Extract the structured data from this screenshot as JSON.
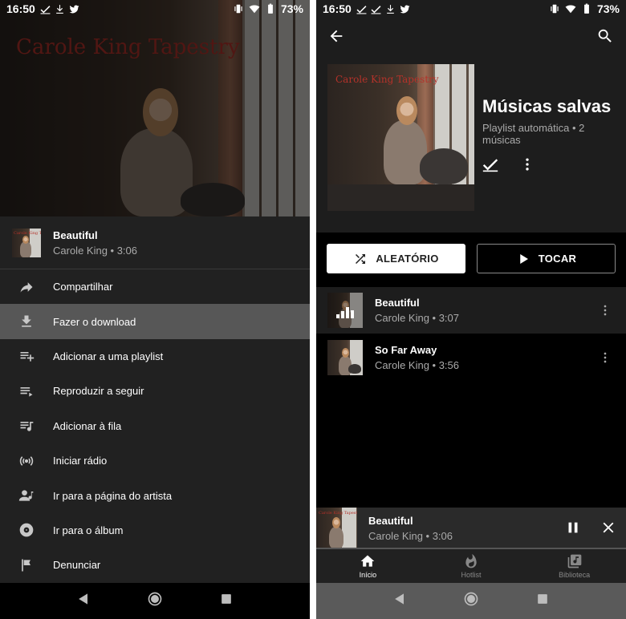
{
  "status_bar": {
    "time": "16:50",
    "battery": "73%"
  },
  "left": {
    "album_title_art": "Carole King Tapestry",
    "song": {
      "title": "Beautiful",
      "subtitle": "Carole King • 3:06"
    },
    "menu": [
      {
        "label": "Compartilhar",
        "icon": "share-icon"
      },
      {
        "label": "Fazer o download",
        "icon": "download-icon"
      },
      {
        "label": "Adicionar a uma playlist",
        "icon": "playlist-add-icon"
      },
      {
        "label": "Reproduzir a seguir",
        "icon": "play-next-icon"
      },
      {
        "label": "Adicionar à fila",
        "icon": "queue-music-icon"
      },
      {
        "label": "Iniciar rádio",
        "icon": "radio-icon"
      },
      {
        "label": "Ir para a página do artista",
        "icon": "artist-icon"
      },
      {
        "label": "Ir para o álbum",
        "icon": "album-icon"
      },
      {
        "label": "Denunciar",
        "icon": "flag-icon"
      }
    ],
    "active_menu_index": 1
  },
  "right": {
    "playlist": {
      "title": "Músicas salvas",
      "subtitle": "Playlist automática • 2 músicas",
      "album_title_art": "Carole King Tapestry"
    },
    "buttons": {
      "shuffle": "ALEATÓRIO",
      "play": "TOCAR"
    },
    "tracks": [
      {
        "title": "Beautiful",
        "subtitle": "Carole King • 3:07",
        "playing": true
      },
      {
        "title": "So Far Away",
        "subtitle": "Carole King • 3:56",
        "playing": false
      }
    ],
    "mini_player": {
      "title": "Beautiful",
      "subtitle": "Carole King • 3:06",
      "progress": 0.0
    },
    "bottom_nav": [
      {
        "label": "Início",
        "icon": "home-icon",
        "active": true
      },
      {
        "label": "Hotlist",
        "icon": "fire-icon",
        "active": false
      },
      {
        "label": "Biblioteca",
        "icon": "library-icon",
        "active": false
      }
    ]
  },
  "colors": {
    "sheet_bg": "#212121",
    "active_row": "#575757",
    "accent_progress": "#ee0000"
  }
}
